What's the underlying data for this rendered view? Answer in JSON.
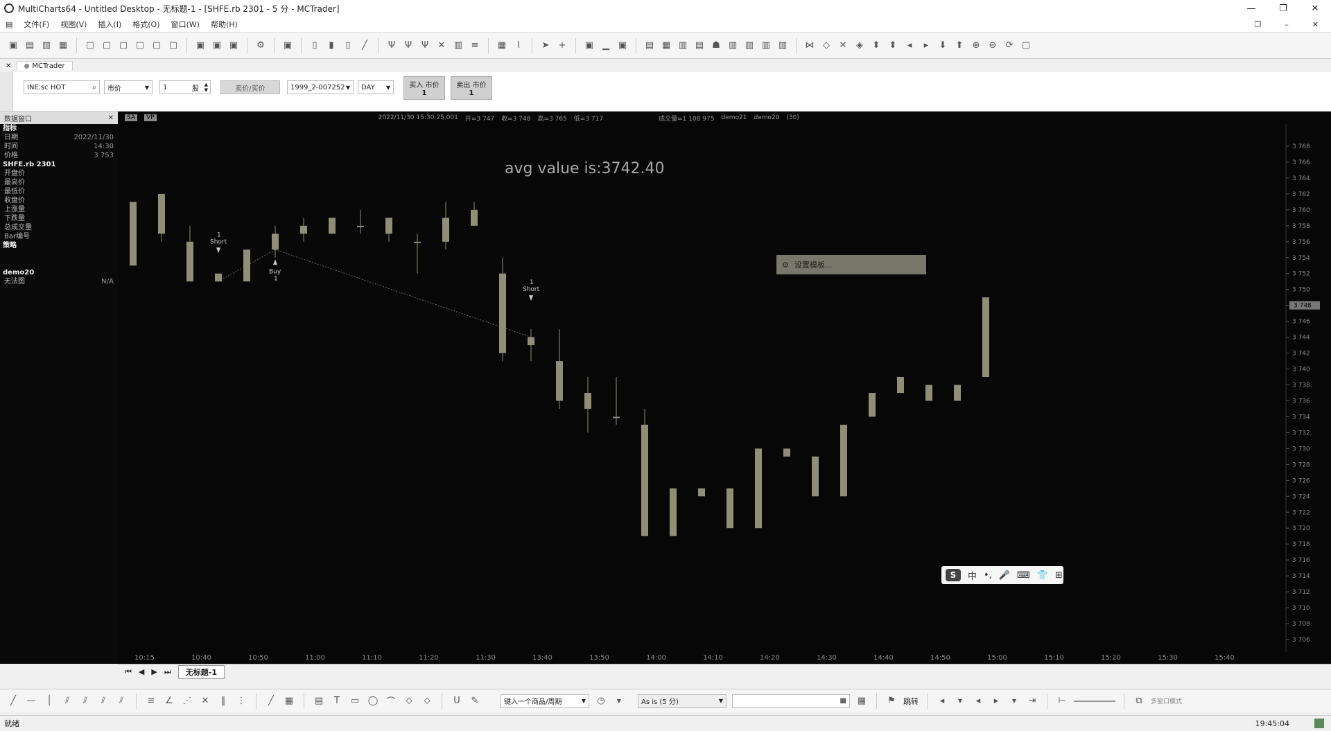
{
  "window": {
    "title": "MultiCharts64 - Untitled Desktop - 无标题-1 - [SHFE.rb 2301 - 5 分 - MCTrader]"
  },
  "menu": [
    "文件(F)",
    "视图(V)",
    "插入(I)",
    "格式(O)",
    "窗口(W)",
    "帮助(H)"
  ],
  "tabs": {
    "active": "MCTrader"
  },
  "trade": {
    "symbol": "INE.sc HOT",
    "order_type": "市价",
    "qty": "1",
    "qty_unit": "股",
    "price_mode": "卖价/买价",
    "account": "1999_2-007252",
    "tif": "DAY",
    "buy_label": "买入 市价",
    "buy_qty": "1",
    "sell_label": "卖出 市价",
    "sell_qty": "1"
  },
  "left_panel": {
    "title": "数据窗口",
    "section1": "指标",
    "rows1": [
      {
        "label": "日期",
        "value": "2022/11/30"
      },
      {
        "label": "时间",
        "value": "14:30"
      },
      {
        "label": "价格",
        "value": "3 753"
      }
    ],
    "section2": "SHFE.rb 2301",
    "rows2": [
      "开盘价",
      "最高价",
      "最低价",
      "收盘价",
      "上涨量",
      "下跌量",
      "总成交量",
      "Bar编号"
    ],
    "section3": "策略",
    "section4": "demo20",
    "rows4": [
      {
        "label": "无法图",
        "value": "N/A"
      }
    ]
  },
  "chart": {
    "badges": [
      "SA",
      "VP"
    ],
    "status_time": "2022/11/30  15:30:25.001",
    "status_open": "开=3 747",
    "status_close": "收=3 748",
    "status_high": "高=3 765",
    "status_low": "低=3 717",
    "status_volume": "成交量=1 108 975",
    "status_demo21": "demo21",
    "status_demo20": "demo20",
    "status_count": "(30)",
    "avg_label": "avg value is:3742.40",
    "context_item": "设置模板...",
    "current_price_label": "3 748"
  },
  "chart_data": {
    "type": "candlestick",
    "y_ticks": [
      "3 768",
      "3 766",
      "3 764",
      "3 762",
      "3 760",
      "3 758",
      "3 756",
      "3 754",
      "3 752",
      "3 750",
      "3 748",
      "3 746",
      "3 744",
      "3 742",
      "3 740",
      "3 738",
      "3 736",
      "3 734",
      "3 732",
      "3 730",
      "3 728",
      "3 726",
      "3 724",
      "3 722",
      "3 720",
      "3 718",
      "3 716",
      "3 714",
      "3 712",
      "3 710",
      "3 708",
      "3 706"
    ],
    "x_ticks": [
      "10:15",
      "10:40",
      "10:50",
      "11:00",
      "11:10",
      "11:20",
      "11:30",
      "13:40",
      "13:50",
      "14:00",
      "14:10",
      "14:20",
      "14:30",
      "14:40",
      "14:50",
      "15:00",
      "15:10",
      "15:20",
      "15:30",
      "15:40"
    ],
    "candles": [
      {
        "o": 3761,
        "c": 3753,
        "h": 3761,
        "l": 3753
      },
      {
        "o": 3762,
        "c": 3757,
        "h": 3762,
        "l": 3756
      },
      {
        "o": 3756,
        "c": 3751,
        "h": 3758,
        "l": 3751
      },
      {
        "o": 3751,
        "c": 3752,
        "h": 3752,
        "l": 3751
      },
      {
        "o": 3751,
        "c": 3755,
        "h": 3755,
        "l": 3751
      },
      {
        "o": 3755,
        "c": 3757,
        "h": 3758,
        "l": 3754
      },
      {
        "o": 3757,
        "c": 3758,
        "h": 3759,
        "l": 3756
      },
      {
        "o": 3757,
        "c": 3759,
        "h": 3759,
        "l": 3757
      },
      {
        "o": 3758,
        "c": 3758,
        "h": 3760,
        "l": 3757
      },
      {
        "o": 3757,
        "c": 3759,
        "h": 3759,
        "l": 3756
      },
      {
        "o": 3756,
        "c": 3756,
        "h": 3757,
        "l": 3752
      },
      {
        "o": 3756,
        "c": 3759,
        "h": 3761,
        "l": 3755
      },
      {
        "o": 3758,
        "c": 3760,
        "h": 3761,
        "l": 3758
      },
      {
        "o": 3742,
        "c": 3752,
        "h": 3754,
        "l": 3741
      },
      {
        "o": 3744,
        "c": 3743,
        "h": 3745,
        "l": 3741
      },
      {
        "o": 3741,
        "c": 3736,
        "h": 3745,
        "l": 3735
      },
      {
        "o": 3737,
        "c": 3735,
        "h": 3739,
        "l": 3732
      },
      {
        "o": 3734,
        "c": 3734,
        "h": 3739,
        "l": 3733
      },
      {
        "o": 3733,
        "c": 3719,
        "h": 3735,
        "l": 3719
      },
      {
        "o": 3725,
        "c": 3719,
        "h": 3725,
        "l": 3719
      },
      {
        "o": 3724,
        "c": 3725,
        "h": 3725,
        "l": 3724
      },
      {
        "o": 3725,
        "c": 3720,
        "h": 3725,
        "l": 3720
      },
      {
        "o": 3720,
        "c": 3730,
        "h": 3730,
        "l": 3720
      },
      {
        "o": 3730,
        "c": 3729,
        "h": 3730,
        "l": 3729
      },
      {
        "o": 3724,
        "c": 3729,
        "h": 3729,
        "l": 3724
      },
      {
        "o": 3724,
        "c": 3733,
        "h": 3733,
        "l": 3724
      },
      {
        "o": 3734,
        "c": 3737,
        "h": 3737,
        "l": 3734
      },
      {
        "o": 3737,
        "c": 3739,
        "h": 3739,
        "l": 3737
      },
      {
        "o": 3736,
        "c": 3738,
        "h": 3738,
        "l": 3736
      },
      {
        "o": 3736,
        "c": 3738,
        "h": 3738,
        "l": 3736
      },
      {
        "o": 3739,
        "c": 3749,
        "h": 3749,
        "l": 3739
      }
    ],
    "signals": [
      {
        "bar": 3,
        "type": "Short",
        "qty": "1",
        "price": 3753
      },
      {
        "bar": 5,
        "type": "Buy",
        "qty": "1",
        "price": 3755
      },
      {
        "bar": 14,
        "type": "Short",
        "qty": "1",
        "price": 3747
      }
    ],
    "trades": [
      {
        "from_bar": 3,
        "from_price": 3751,
        "to_bar": 5,
        "to_price": 3755
      },
      {
        "from_bar": 5,
        "from_price": 3755,
        "to_bar": 14,
        "to_price": 3744
      }
    ],
    "colors": {
      "candle": "#8f8f78",
      "background": "#070707",
      "text": "#a8a8a8"
    }
  },
  "sheet": {
    "tab": "无标题-1"
  },
  "drawbar": {
    "symbol_placeholder": "键入一个商品/周期",
    "resolution": "As is (5 分)",
    "jump": "跳转",
    "trade_mode": "多窗口模式"
  },
  "status": {
    "ready": "就绪",
    "clock": "19:45:04"
  }
}
